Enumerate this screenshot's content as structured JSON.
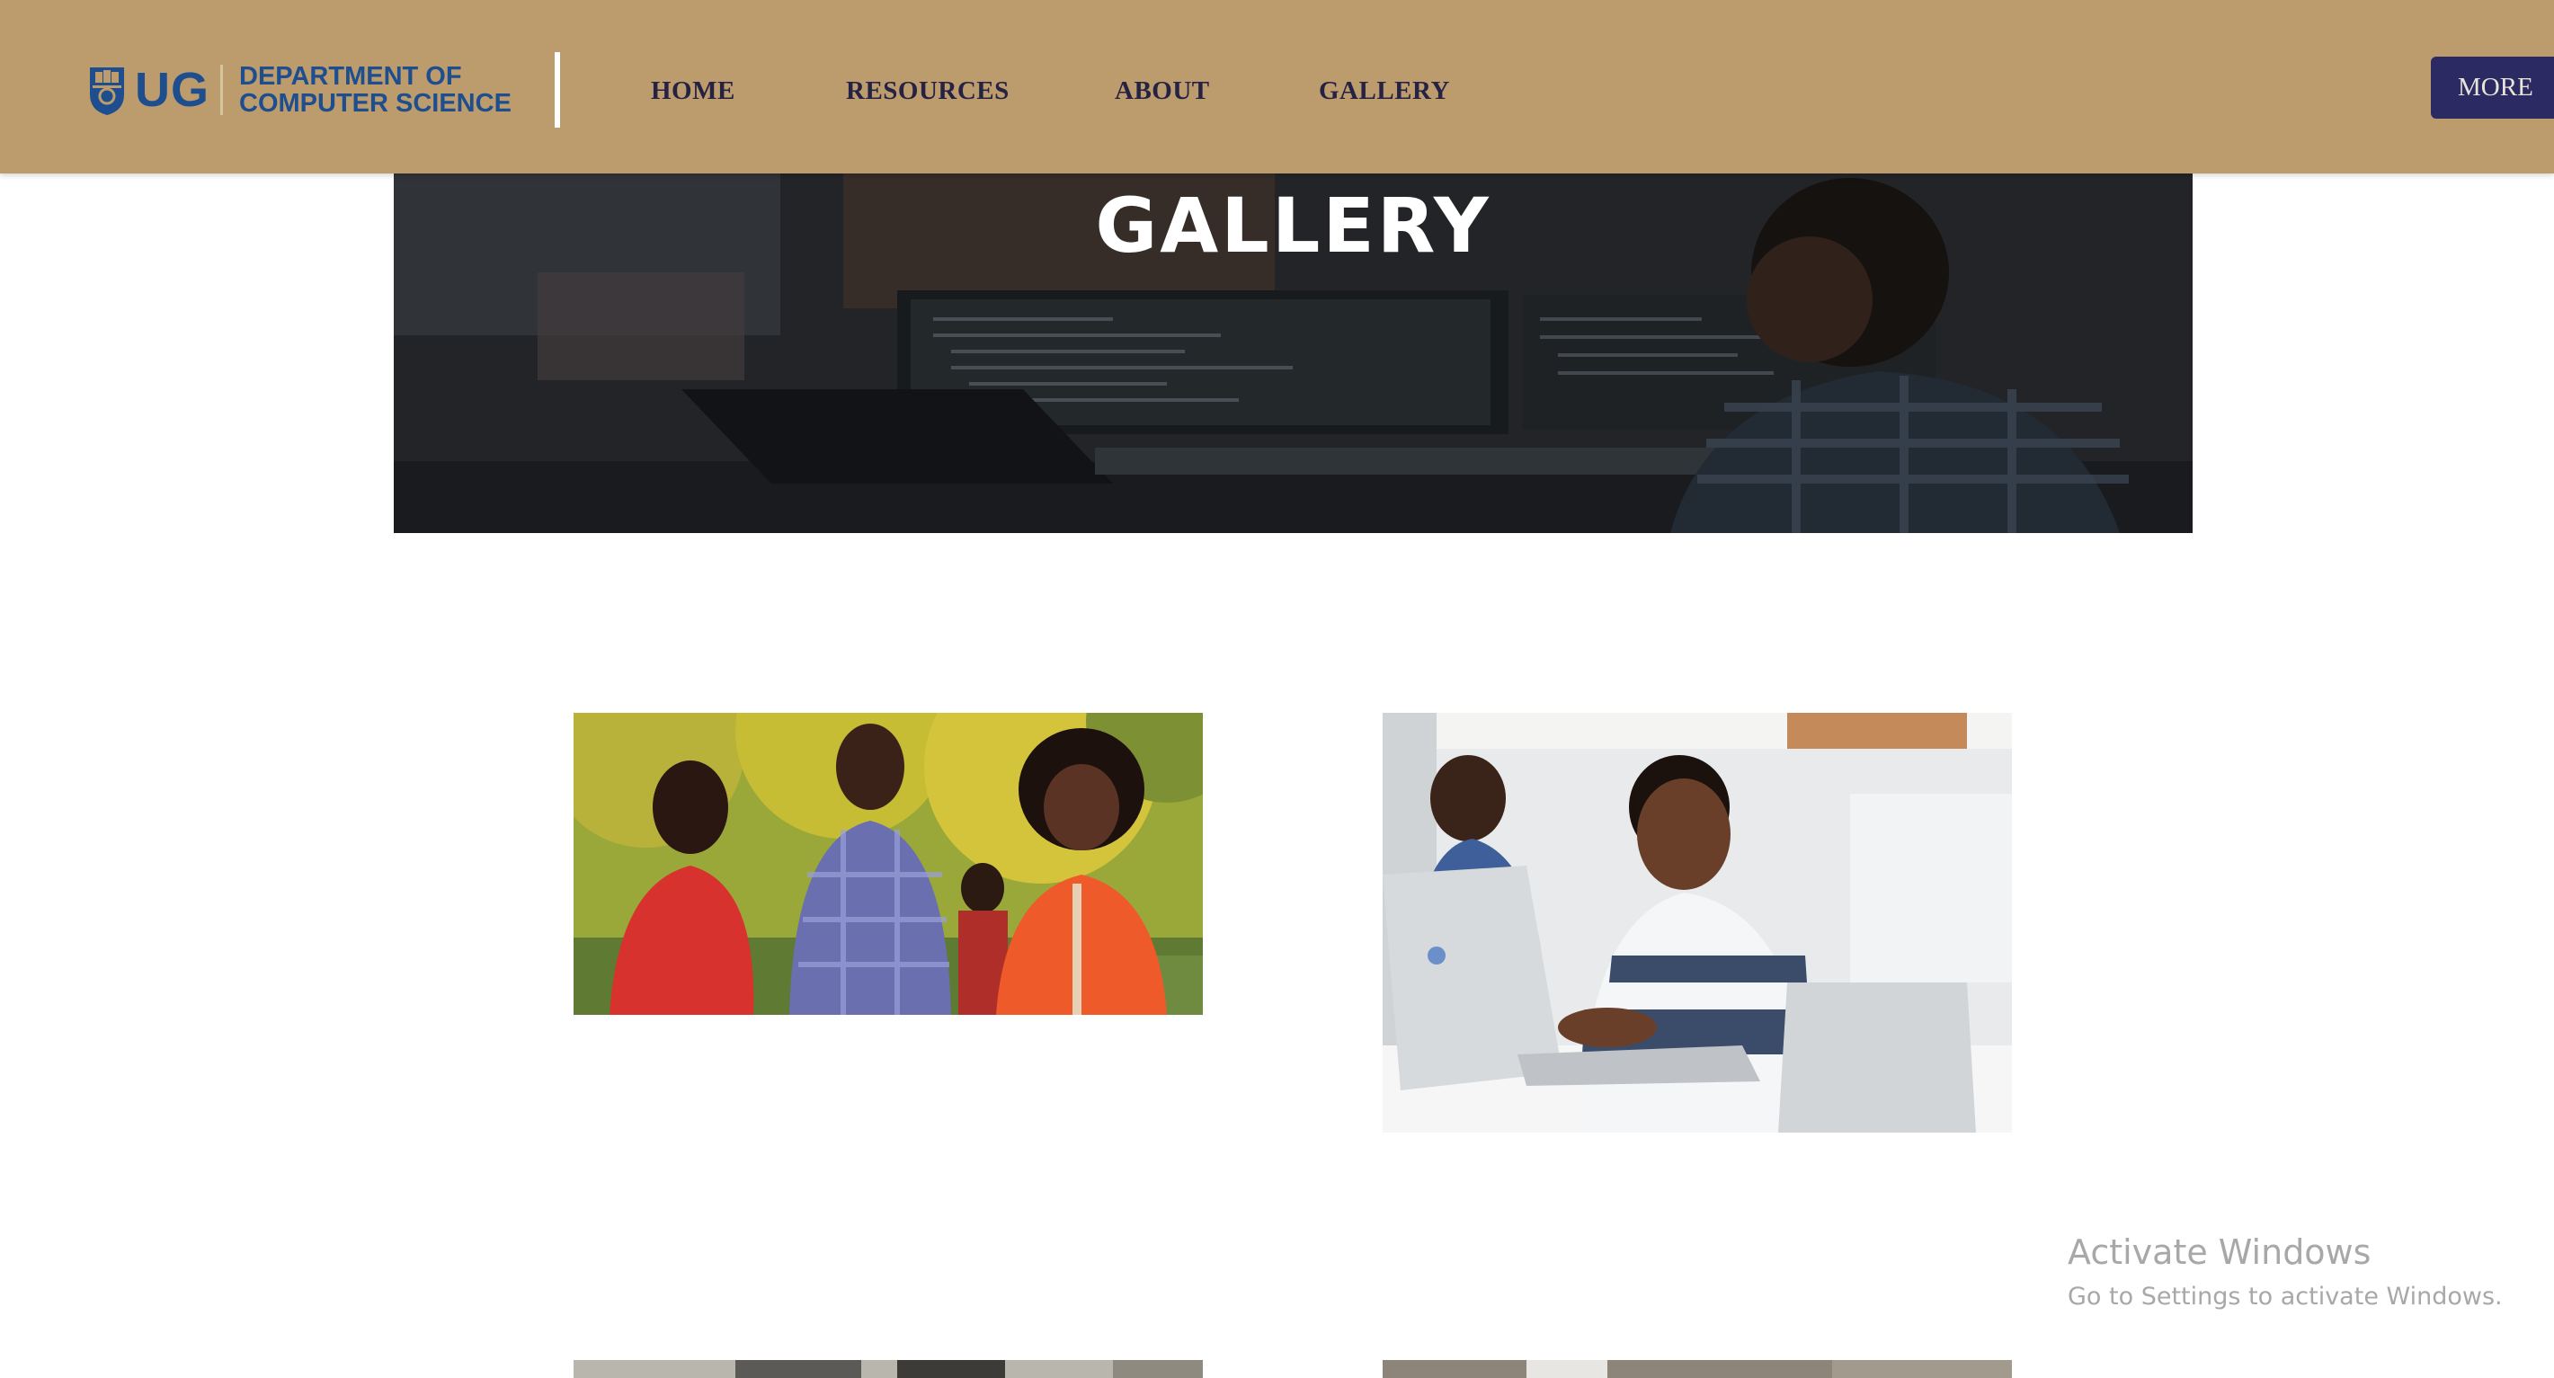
{
  "header": {
    "logo_mark": "UG",
    "logo_text": "DEPARTMENT OF\nCOMPUTER SCIENCE",
    "nav": [
      {
        "label": "HOME"
      },
      {
        "label": "RESOURCES"
      },
      {
        "label": "ABOUT"
      },
      {
        "label": "GALLERY"
      }
    ],
    "more_label": "MORE"
  },
  "hero": {
    "title": "GALLERY"
  },
  "gallery": {
    "photos": [
      {
        "subject": "students-talking-outdoors-photo"
      },
      {
        "subject": "student-using-laptop-photo"
      },
      {
        "subject": "building-photo"
      },
      {
        "subject": "room-photo"
      }
    ]
  },
  "watermark": {
    "title": "Activate Windows",
    "subtitle": "Go to Settings to activate Windows."
  },
  "colors": {
    "header_bg": "#bc9c6c",
    "brand_blue": "#1f4e8f",
    "nav_text": "#262244",
    "more_button_bg": "#2c2a62"
  }
}
